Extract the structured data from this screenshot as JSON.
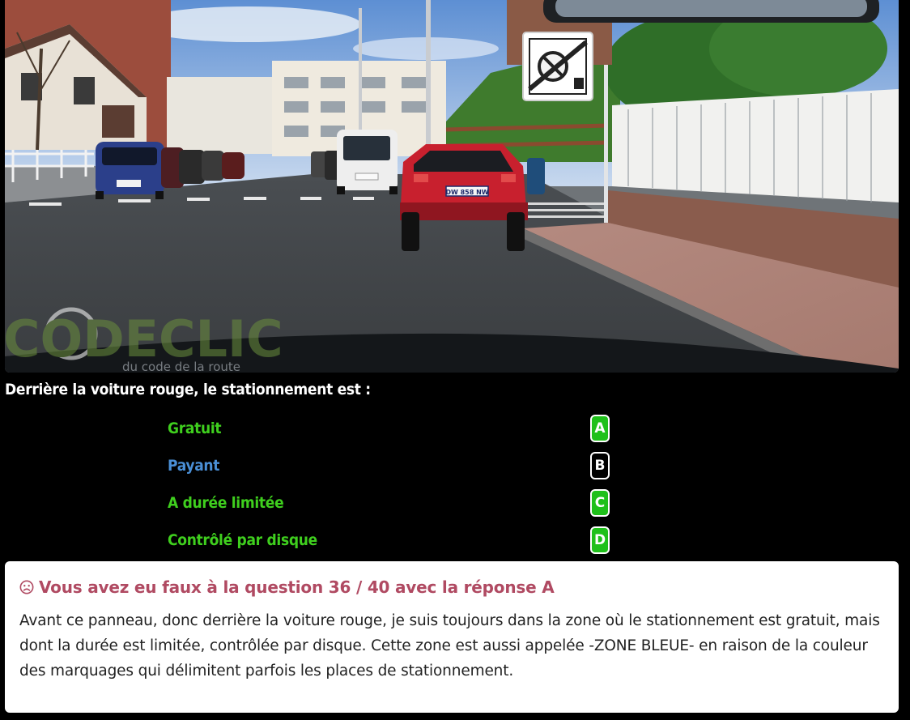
{
  "scene": {
    "watermark": "CODECLIC",
    "watermark_sub": "du code de la route",
    "plate_red_car": "DW 858 NW",
    "plate_blue_car": "",
    "sign_icon": "end-of-blue-zone-sign-icon"
  },
  "question": {
    "text": "Derrière la voiture rouge, le stationnement est :"
  },
  "answers": [
    {
      "label": "Gratuit",
      "letter": "A",
      "color": "#3fcf1e",
      "badge_color": "#1fc01a"
    },
    {
      "label": "Payant",
      "letter": "B",
      "color": "#4a8fd6",
      "badge_color": "#000000"
    },
    {
      "label": "A durée limitée",
      "letter": "C",
      "color": "#3fcf1e",
      "badge_color": "#1fc01a"
    },
    {
      "label": "Contrôlé par disque",
      "letter": "D",
      "color": "#3fcf1e",
      "badge_color": "#1fc01a"
    }
  ],
  "feedback": {
    "icon": "sad-face-icon",
    "title": "Vous avez eu faux à la question 36 / 40 avec la réponse A",
    "title_color": "#b04a62",
    "body": "Avant ce panneau, donc derrière la voiture rouge, je suis toujours dans la zone où le stationnement est gratuit, mais dont la durée est limitée, contrôlée par disque. Cette zone est aussi appelée -ZONE BLEUE- en raison de la couleur des marquages qui délimitent parfois les places de stationnement."
  }
}
